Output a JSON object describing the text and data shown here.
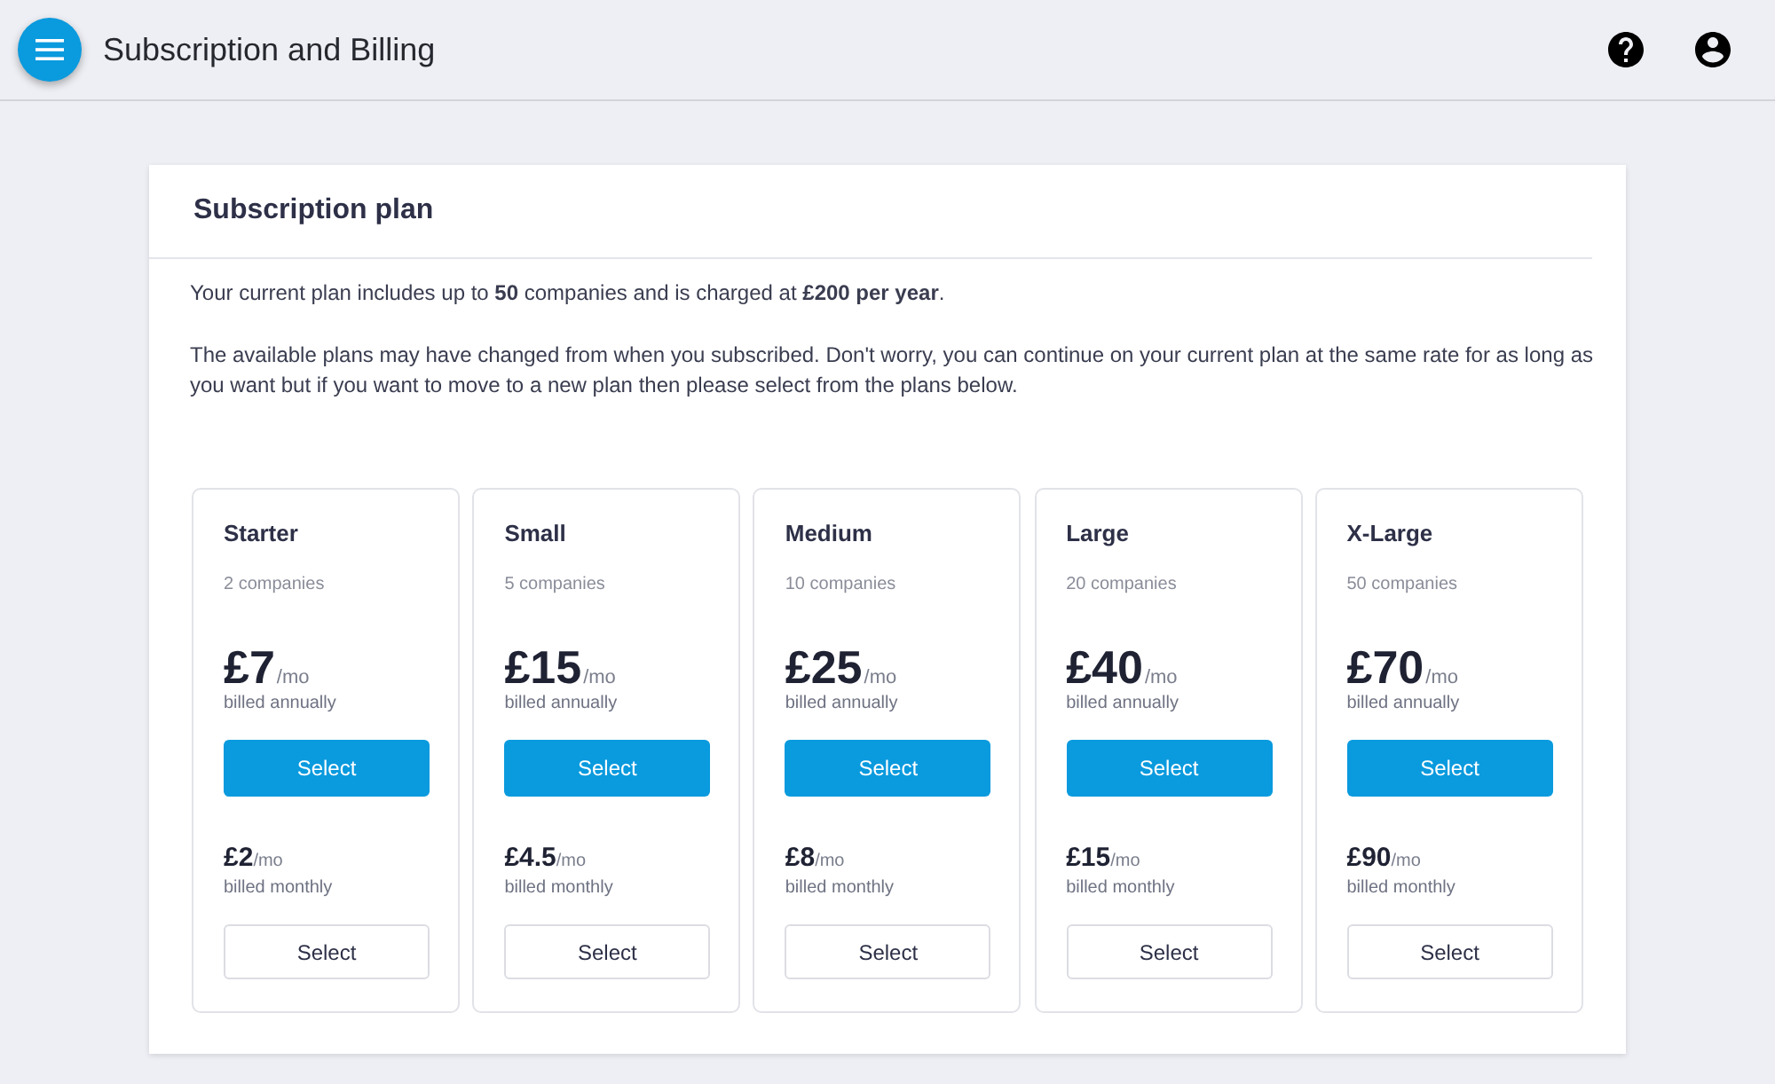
{
  "app_bar": {
    "title": "Subscription and Billing"
  },
  "panel": {
    "title": "Subscription plan",
    "summary": "Your current plan includes up to **50** companies and is charged at **£200 per year**.",
    "note": "The available plans may have changed from when you subscribed. Don't worry, you can continue on your current plan at the same rate for as long as you want but if you want to move to a new plan then please select from the plans below."
  },
  "plans": [
    {
      "name": "Starter",
      "companies": "2 companies",
      "annual": {
        "price": "£7",
        "unit": "/mo",
        "billing": "billed annually",
        "button": "Select"
      },
      "monthly": {
        "price": "£2",
        "unit": "/mo",
        "billing": "billed monthly",
        "button": "Select"
      }
    },
    {
      "name": "Small",
      "companies": "5 companies",
      "annual": {
        "price": "£15",
        "unit": "/mo",
        "billing": "billed annually",
        "button": "Select"
      },
      "monthly": {
        "price": "£4.5",
        "unit": "/mo",
        "billing": "billed monthly",
        "button": "Select"
      }
    },
    {
      "name": "Medium",
      "companies": "10 companies",
      "annual": {
        "price": "£25",
        "unit": "/mo",
        "billing": "billed annually",
        "button": "Select"
      },
      "monthly": {
        "price": "£8",
        "unit": "/mo",
        "billing": "billed monthly",
        "button": "Select"
      }
    },
    {
      "name": "Large",
      "companies": "20 companies",
      "annual": {
        "price": "£40",
        "unit": "/mo",
        "billing": "billed annually",
        "button": "Select"
      },
      "monthly": {
        "price": "£15",
        "unit": "/mo",
        "billing": "billed monthly",
        "button": "Select"
      }
    },
    {
      "name": "X-Large",
      "companies": "50 companies",
      "annual": {
        "price": "£70",
        "unit": "/mo",
        "billing": "billed annually",
        "button": "Select"
      },
      "monthly": {
        "price": "£90",
        "unit": "/mo",
        "billing": "billed monthly",
        "button": "Select"
      }
    }
  ]
}
